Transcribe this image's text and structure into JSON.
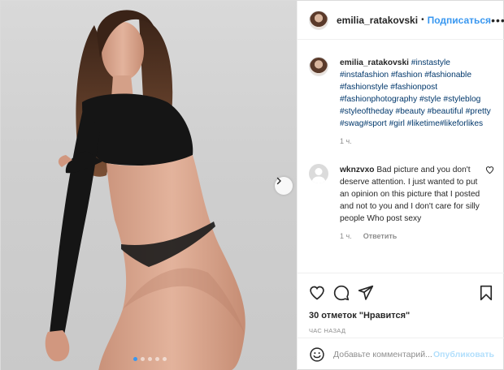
{
  "post": {
    "username": "emilia_ratakovski",
    "follow_separator": "•",
    "follow_label": "Подписаться",
    "more_label": "•••"
  },
  "caption": {
    "username": "emilia_ratakovski",
    "hashtags": "#instastyle #instafashion #fashion #fashionable #fashionstyle #fashionpost #fashionphotography #style #styleblog #styleoftheday #beauty #beautiful #pretty #swag#sport #girl #liketime#likeforlikes",
    "time": "1 ч."
  },
  "comments": [
    {
      "username": "wknzvxo",
      "text": "Bad picture and you don't deserve attention. I just wanted to put an opinion on this picture that I posted and not to you and I don't care for silly people Who post sexy",
      "time": "1 ч.",
      "reply_label": "Ответить"
    }
  ],
  "actions": {
    "likes": "30 отметок \"Нравится\"",
    "posted_ago": "ЧАС НАЗАД"
  },
  "add_comment": {
    "placeholder": "Добавьте комментарий...",
    "publish_label": "Опубликовать"
  },
  "carousel": {
    "slide_count": 5,
    "active_index": 0
  },
  "colors": {
    "accent": "#3897f0",
    "hashtag": "#00376b",
    "muted": "#8e8e8e"
  },
  "icons": [
    "chevron-right-icon",
    "heart-icon",
    "comment-icon",
    "share-icon",
    "bookmark-icon",
    "emoji-icon",
    "small-heart-icon",
    "default-avatar-icon"
  ]
}
